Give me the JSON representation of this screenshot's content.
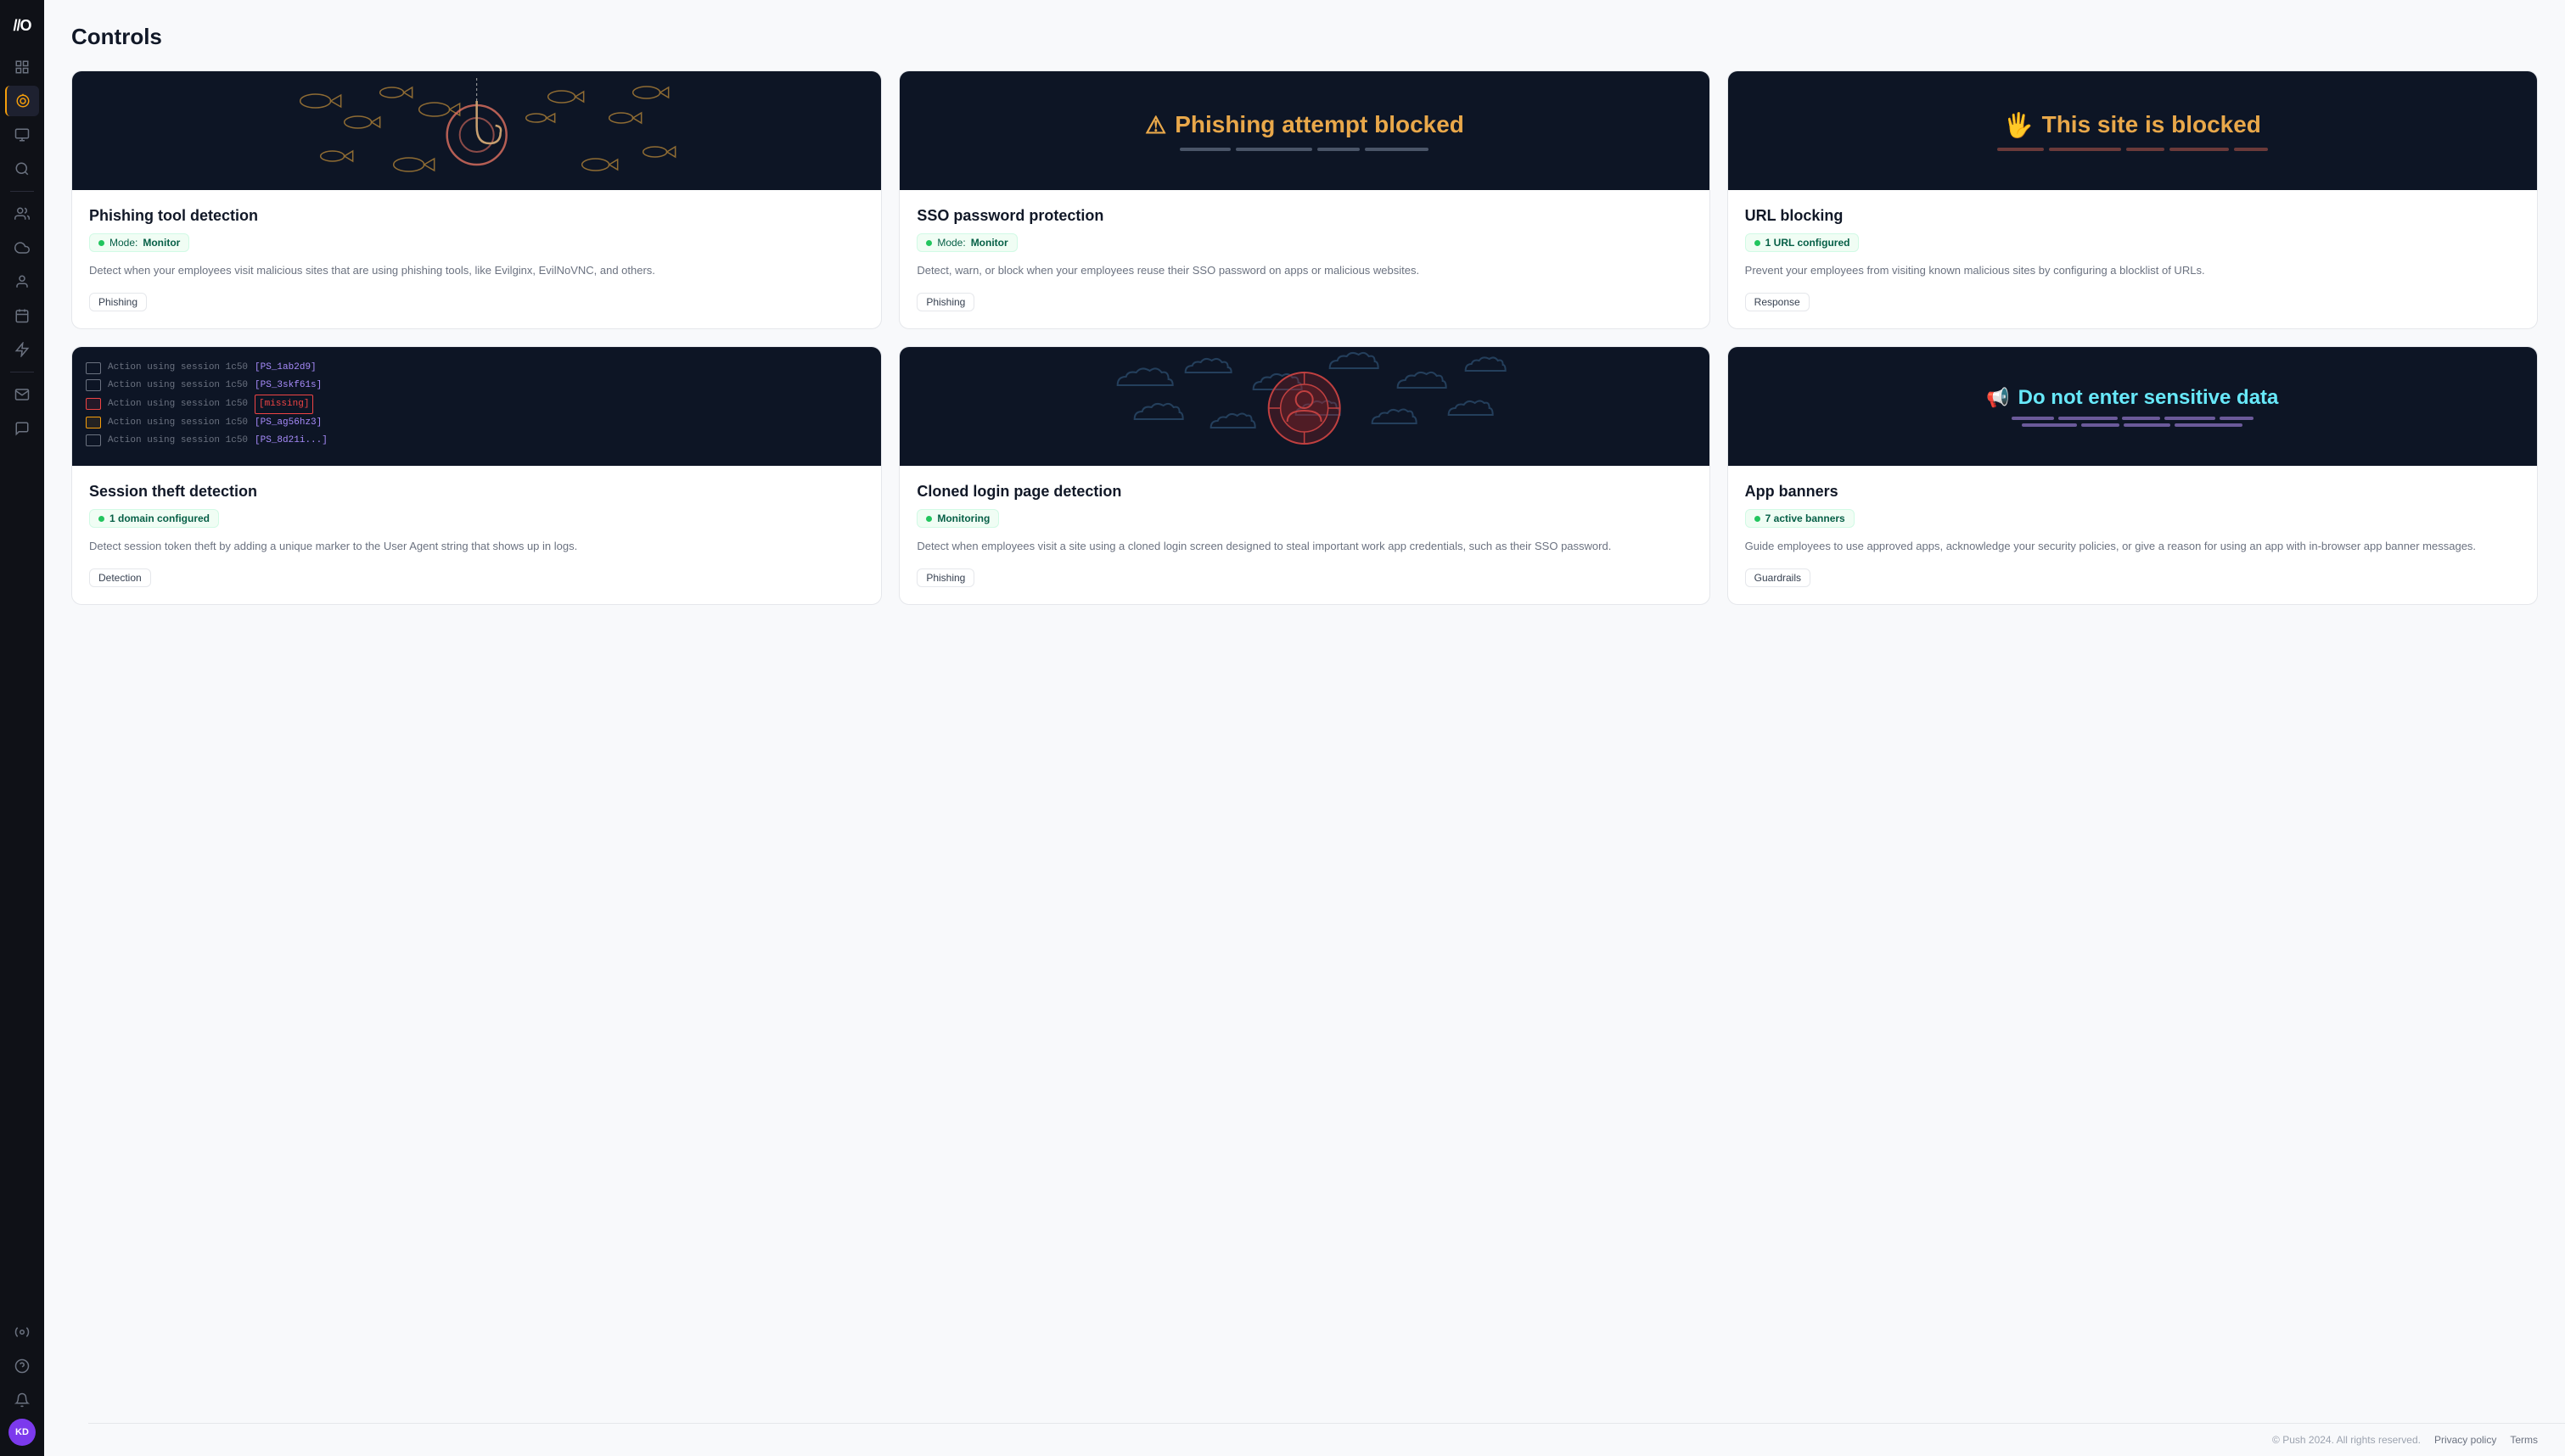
{
  "sidebar": {
    "logo": "//O",
    "items": [
      {
        "id": "dashboard",
        "icon": "▦",
        "active": false
      },
      {
        "id": "target",
        "icon": "◎",
        "active": true
      },
      {
        "id": "monitor",
        "icon": "▤",
        "active": false
      },
      {
        "id": "search",
        "icon": "⌕",
        "active": false
      },
      {
        "id": "users",
        "icon": "👥",
        "active": false
      },
      {
        "id": "cloud",
        "icon": "☁",
        "active": false
      },
      {
        "id": "person",
        "icon": "👤",
        "active": false
      },
      {
        "id": "calendar",
        "icon": "▦",
        "active": false
      },
      {
        "id": "lightning",
        "icon": "⚡",
        "active": false
      },
      {
        "id": "mail",
        "icon": "✉",
        "active": false
      },
      {
        "id": "chat",
        "icon": "💬",
        "active": false
      },
      {
        "id": "settings",
        "icon": "⚙",
        "active": false
      },
      {
        "id": "help",
        "icon": "?",
        "active": false
      },
      {
        "id": "bell",
        "icon": "🔔",
        "active": false
      }
    ],
    "avatar": "KD"
  },
  "page": {
    "title": "Controls"
  },
  "cards": [
    {
      "id": "phishing-tool",
      "banner_type": "phishing",
      "title": "Phishing tool detection",
      "badge_label": "Mode:",
      "badge_value": "Monitor",
      "description": "Detect when your employees visit malicious sites that are using phishing tools, like Evilginx, EvilNoVNC, and others.",
      "tag": "Phishing"
    },
    {
      "id": "sso-password",
      "banner_type": "sso",
      "title": "SSO password protection",
      "badge_label": "Mode:",
      "badge_value": "Monitor",
      "description": "Detect, warn, or block when your employees reuse their SSO password on apps or malicious websites.",
      "tag": "Phishing"
    },
    {
      "id": "url-blocking",
      "banner_type": "url",
      "title": "URL blocking",
      "badge_label": "",
      "badge_value": "1 URL configured",
      "description": "Prevent your employees from visiting known malicious sites by configuring a blocklist of URLs.",
      "tag": "Response"
    },
    {
      "id": "session-theft",
      "banner_type": "session",
      "title": "Session theft detection",
      "badge_label": "",
      "badge_value": "1 domain configured",
      "description": "Detect session token theft by adding a unique marker to the User Agent string that shows up in logs.",
      "tag": "Detection"
    },
    {
      "id": "cloned-login",
      "banner_type": "cloned",
      "title": "Cloned login page detection",
      "badge_label": "",
      "badge_value": "Monitoring",
      "description": "Detect when employees visit a site using a cloned login screen designed to steal important work app credentials, such as their SSO password.",
      "tag": "Phishing"
    },
    {
      "id": "app-banners",
      "banner_type": "appbanners",
      "title": "App banners",
      "badge_label": "",
      "badge_value": "7 active banners",
      "description": "Guide employees to use approved apps, acknowledge your security policies, or give a reason for using an app with in-browser app banner messages.",
      "tag": "Guardrails"
    }
  ],
  "footer": {
    "copyright": "© Push 2024. All rights reserved.",
    "privacy_label": "Privacy policy",
    "terms_label": "Terms"
  }
}
